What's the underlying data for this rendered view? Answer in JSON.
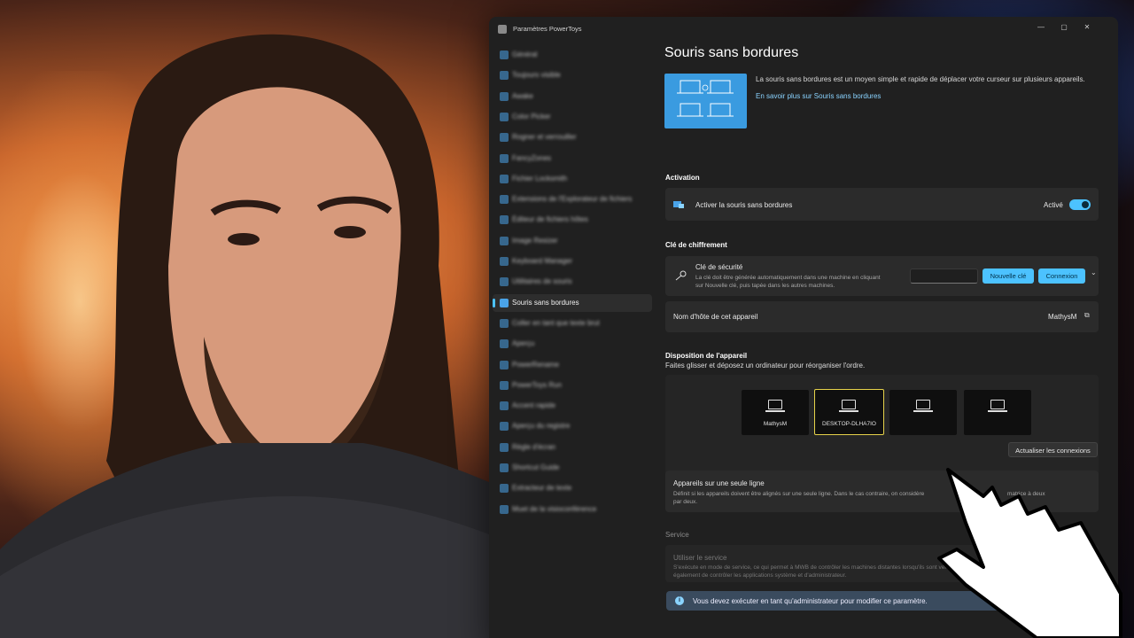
{
  "window": {
    "title": "Paramètres PowerToys",
    "minimize": "—",
    "maximize": "▢",
    "close": "✕"
  },
  "sidebar": {
    "items": [
      {
        "label": "Général",
        "active": false
      },
      {
        "label": "Toujours visible",
        "active": false
      },
      {
        "label": "Awake",
        "active": false
      },
      {
        "label": "Color Picker",
        "active": false
      },
      {
        "label": "Rogner et verrouiller",
        "active": false
      },
      {
        "label": "FancyZones",
        "active": false
      },
      {
        "label": "Fichier Locksmith",
        "active": false
      },
      {
        "label": "Extensions de l'Explorateur de fichiers",
        "active": false
      },
      {
        "label": "Éditeur de fichiers hôtes",
        "active": false
      },
      {
        "label": "Image Resizer",
        "active": false
      },
      {
        "label": "Keyboard Manager",
        "active": false
      },
      {
        "label": "Utilitaires de souris",
        "active": false
      },
      {
        "label": "Souris sans bordures",
        "active": true
      },
      {
        "label": "Coller en tant que texte brut",
        "active": false
      },
      {
        "label": "Aperçu",
        "active": false
      },
      {
        "label": "PowerRename",
        "active": false
      },
      {
        "label": "PowerToys Run",
        "active": false
      },
      {
        "label": "Accent rapide",
        "active": false
      },
      {
        "label": "Aperçu du registre",
        "active": false
      },
      {
        "label": "Règle d'écran",
        "active": false
      },
      {
        "label": "Shortcut Guide",
        "active": false
      },
      {
        "label": "Extracteur de texte",
        "active": false
      },
      {
        "label": "Muet de la visioconférence",
        "active": false
      }
    ]
  },
  "main": {
    "title": "Souris sans bordures",
    "intro": {
      "description": "La souris sans bordures est un moyen simple et rapide de déplacer votre curseur sur plusieurs appareils.",
      "link": "En savoir plus sur Souris sans bordures"
    },
    "activation": {
      "section": "Activation",
      "label": "Activer la souris sans bordures",
      "state": "Activé",
      "enabled": true
    },
    "encryption": {
      "section": "Clé de chiffrement",
      "key_label": "Clé de sécurité",
      "key_desc_1": "La clé doit être générée automatiquement dans une machine en cliquant",
      "key_desc_2": "sur Nouvelle clé, puis tapée dans les autres machines.",
      "key_value": "",
      "new_key": "Nouvelle clé",
      "connect": "Connexion",
      "hostname_label": "Nom d'hôte de cet appareil",
      "hostname_value": "MathysM"
    },
    "layout": {
      "section": "Disposition de l'appareil",
      "subtitle": "Faites glisser et déposez un ordinateur pour réorganiser l'ordre.",
      "devices": [
        "MathysM",
        "DESKTOP-DLHA7IO",
        "",
        ""
      ],
      "refresh": "Actualiser les connexions"
    },
    "single_line": {
      "label": "Appareils sur une seule ligne",
      "desc_1": "Définit si les appareils doivent être alignés sur une seule ligne. Dans le cas contraire, on considère",
      "desc_1b": "matrice à deux",
      "desc_2": "par deux."
    },
    "service": {
      "section": "Service",
      "label": "Utiliser le service",
      "desc_1": "S'exécute en mode de service, ce qui permet à MWB de contrôler les machines distantes lorsqu'ils sont verrouillés",
      "desc_2": "également de contrôler les applications système et d'administrateur."
    },
    "admin_notice": "Vous devez exécuter en tant qu'administrateur pour modifier ce paramètre."
  },
  "colors": {
    "accent": "#4cc2ff",
    "window_bg": "#202020",
    "card_bg": "#2b2b2b",
    "selected_device_border": "#e6d24a"
  }
}
